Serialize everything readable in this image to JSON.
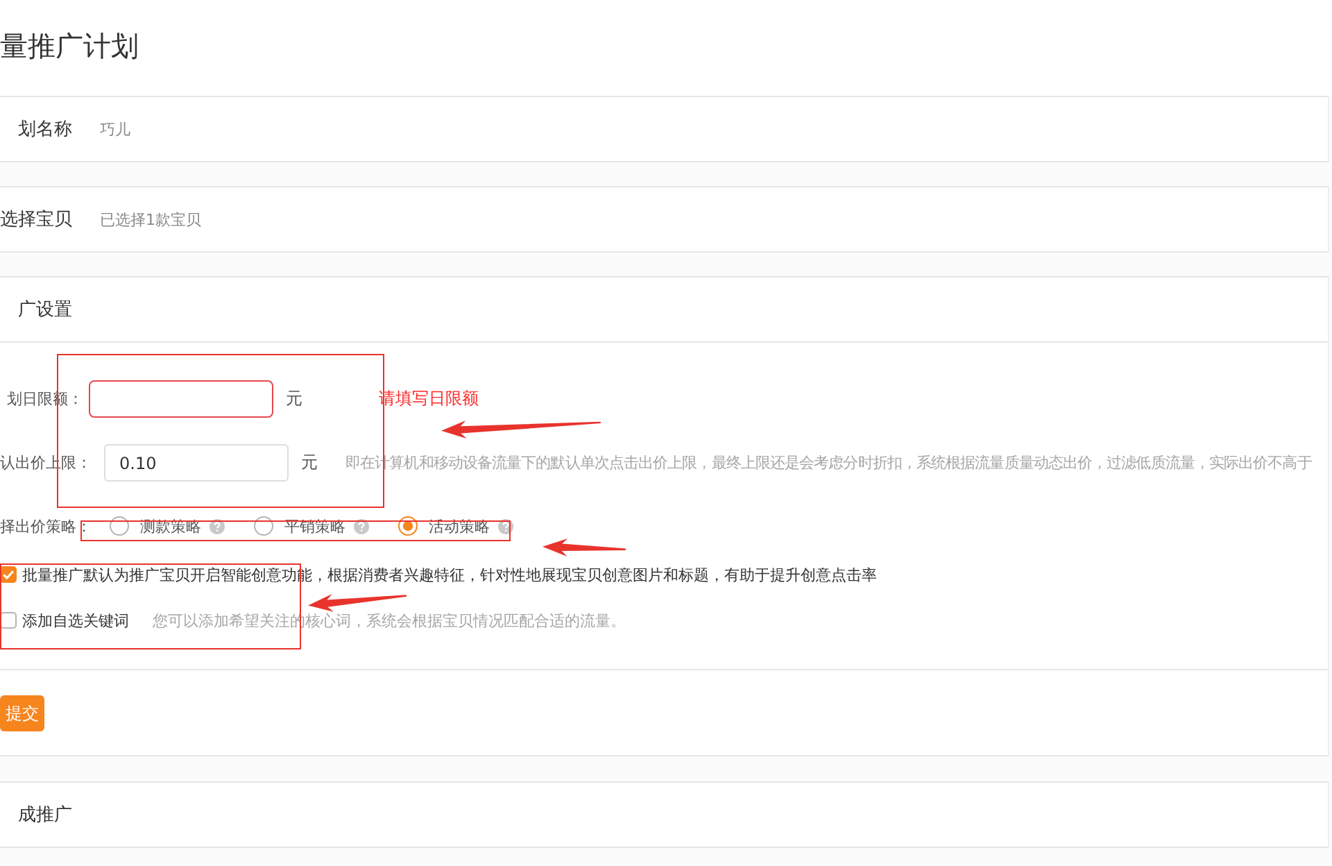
{
  "page": {
    "title": "量推广计划"
  },
  "plan_name": {
    "label": "划名称",
    "value": "巧儿"
  },
  "item_selection": {
    "label": "选择宝贝",
    "value": "已选择1款宝贝"
  },
  "settings": {
    "heading": "广设置",
    "daily_limit": {
      "label": "划日限额：",
      "invalid": true,
      "unit": "元",
      "error": "请填写日限额"
    },
    "default_bid": {
      "label": "认出价上限：",
      "invalid": false,
      "value": "0.10",
      "unit": "元",
      "hint": "即在计算机和移动设备流量下的默认单次点击出价上限，最终上限还是会考虑分时折扣，系统根据流量质量动态出价，过滤低质流量，实际出价不高于"
    },
    "bid_strategy": {
      "label": "择出价策略：",
      "options": [
        {
          "label": "测款策略",
          "selected": false
        },
        {
          "label": "平销策略",
          "selected": false
        },
        {
          "label": "活动策略",
          "selected": true
        }
      ]
    },
    "checkboxes": [
      {
        "label": "批量推广默认为推广宝贝开启智能创意功能，根据消费者兴趣特征，针对性地展现宝贝创意图片和标题，有助于提升创意点击率",
        "checked": true
      },
      {
        "label": "添加自选关键词",
        "checked": false,
        "hint": "您可以添加希望关注的核心词，系统会根据宝贝情况匹配合适的流量。"
      }
    ],
    "submit_button": {
      "label": "提交"
    }
  },
  "next_step": {
    "heading": "成推广"
  }
}
